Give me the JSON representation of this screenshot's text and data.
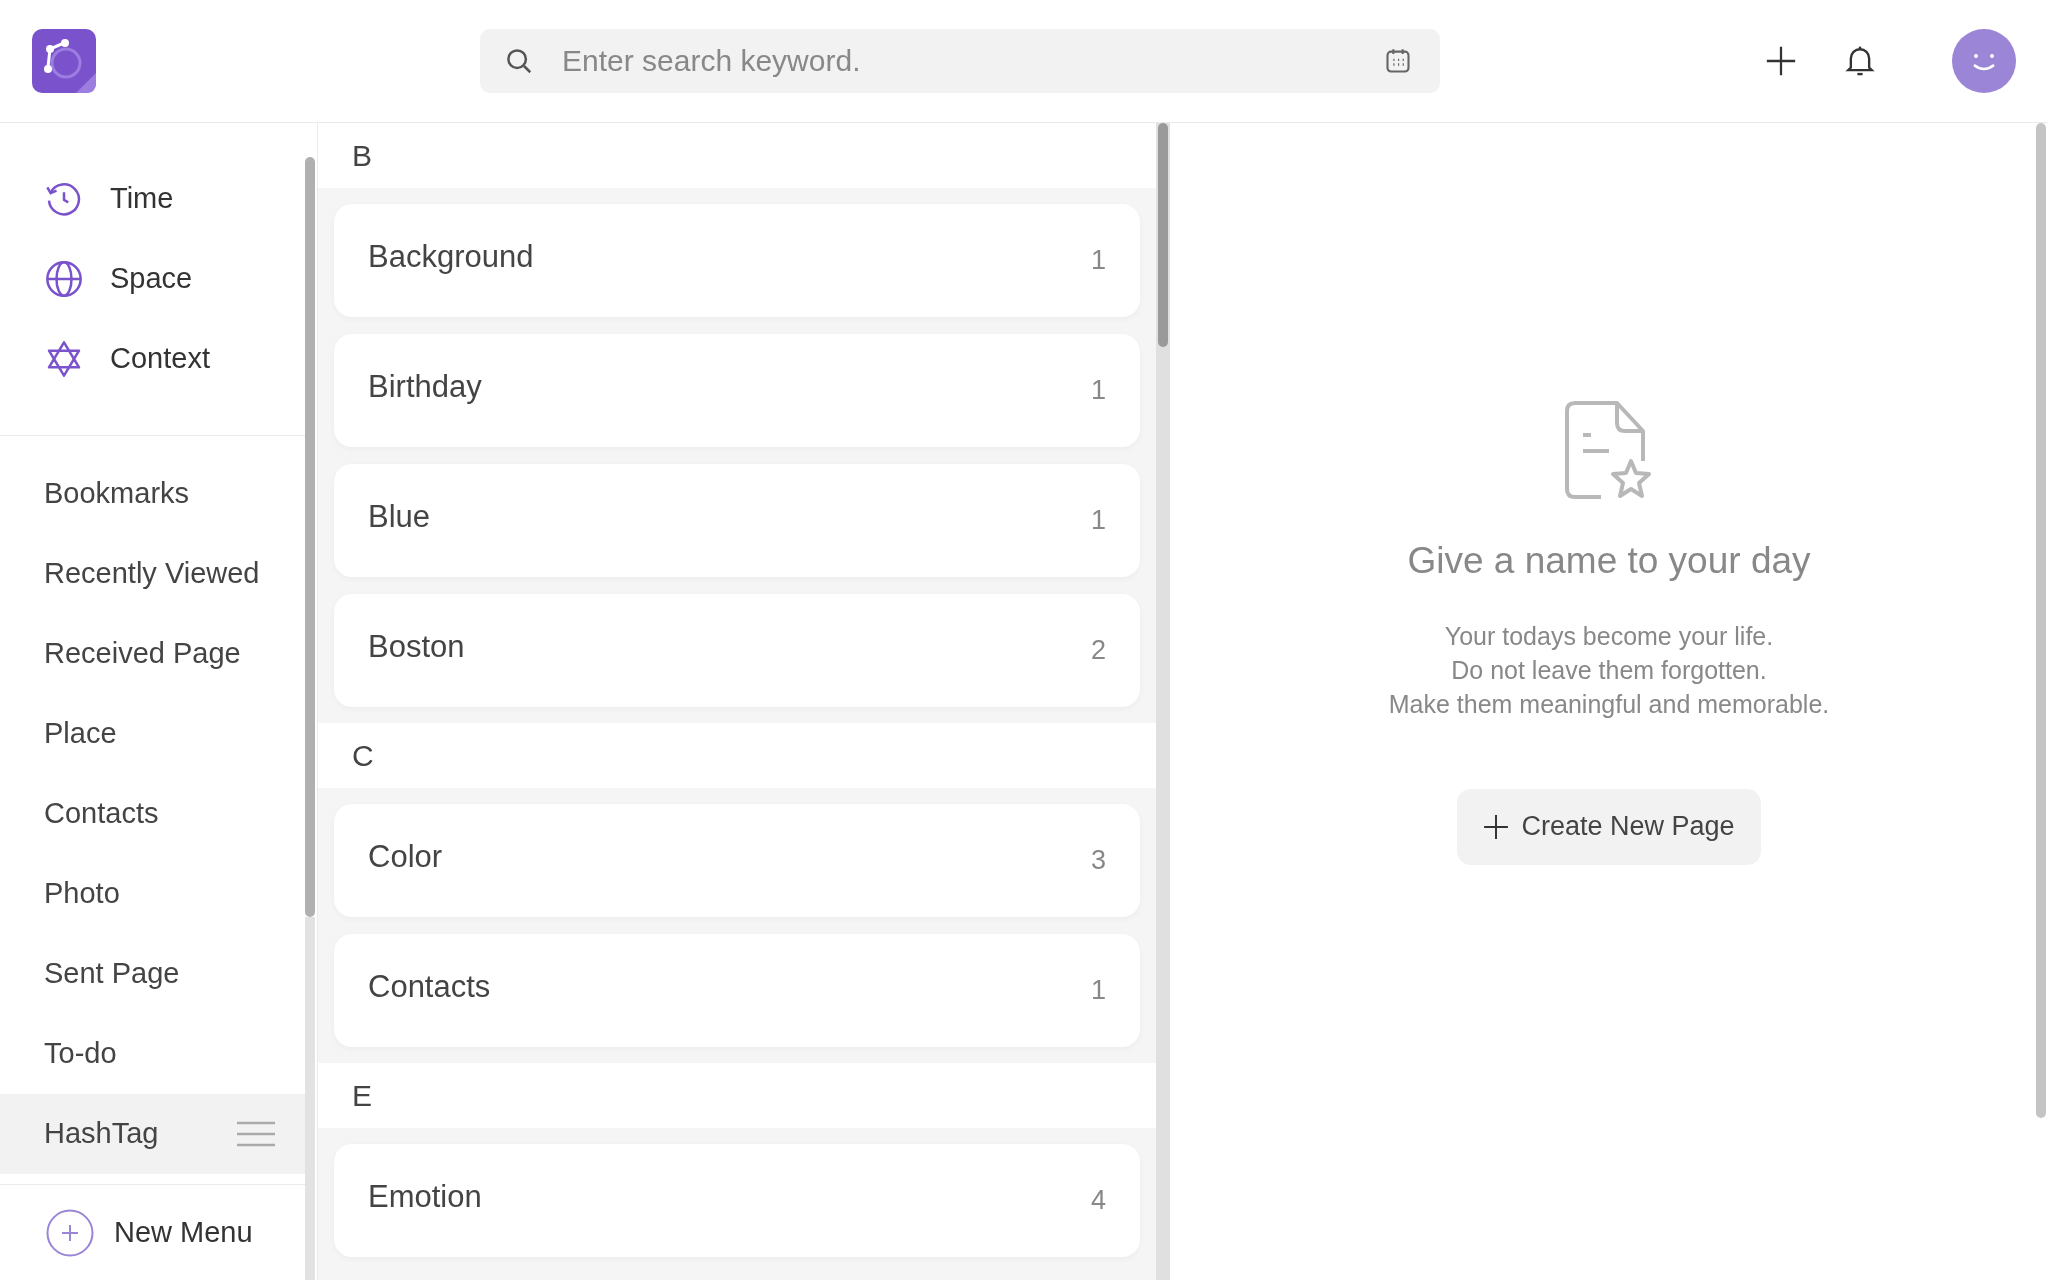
{
  "search": {
    "placeholder": "Enter search keyword."
  },
  "sidebar": {
    "views": [
      {
        "label": "Time",
        "selected": false
      },
      {
        "label": "Space",
        "selected": false
      },
      {
        "label": "Context",
        "selected": false
      }
    ],
    "items": [
      {
        "label": "Bookmarks",
        "selected": false
      },
      {
        "label": "Recently Viewed",
        "selected": false
      },
      {
        "label": "Received Page",
        "selected": false
      },
      {
        "label": "Place",
        "selected": false
      },
      {
        "label": "Contacts",
        "selected": false
      },
      {
        "label": "Photo",
        "selected": false
      },
      {
        "label": "Sent Page",
        "selected": false
      },
      {
        "label": "To-do",
        "selected": false
      },
      {
        "label": "HashTag",
        "selected": true
      }
    ],
    "new_menu": "New Menu"
  },
  "tag_groups": [
    {
      "letter": "B",
      "tags": [
        {
          "name": "Background",
          "count": "1"
        },
        {
          "name": "Birthday",
          "count": "1"
        },
        {
          "name": "Blue",
          "count": "1"
        },
        {
          "name": "Boston",
          "count": "2"
        }
      ]
    },
    {
      "letter": "C",
      "tags": [
        {
          "name": "Color",
          "count": "3"
        },
        {
          "name": "Contacts",
          "count": "1"
        }
      ]
    },
    {
      "letter": "E",
      "tags": [
        {
          "name": "Emotion",
          "count": "4"
        }
      ]
    }
  ],
  "empty_state": {
    "title": "Give a name to your day",
    "lines": [
      "Your todays become your life.",
      "Do not leave them forgotten.",
      "Make them meaningful and memorable."
    ],
    "button": "Create New Page"
  }
}
